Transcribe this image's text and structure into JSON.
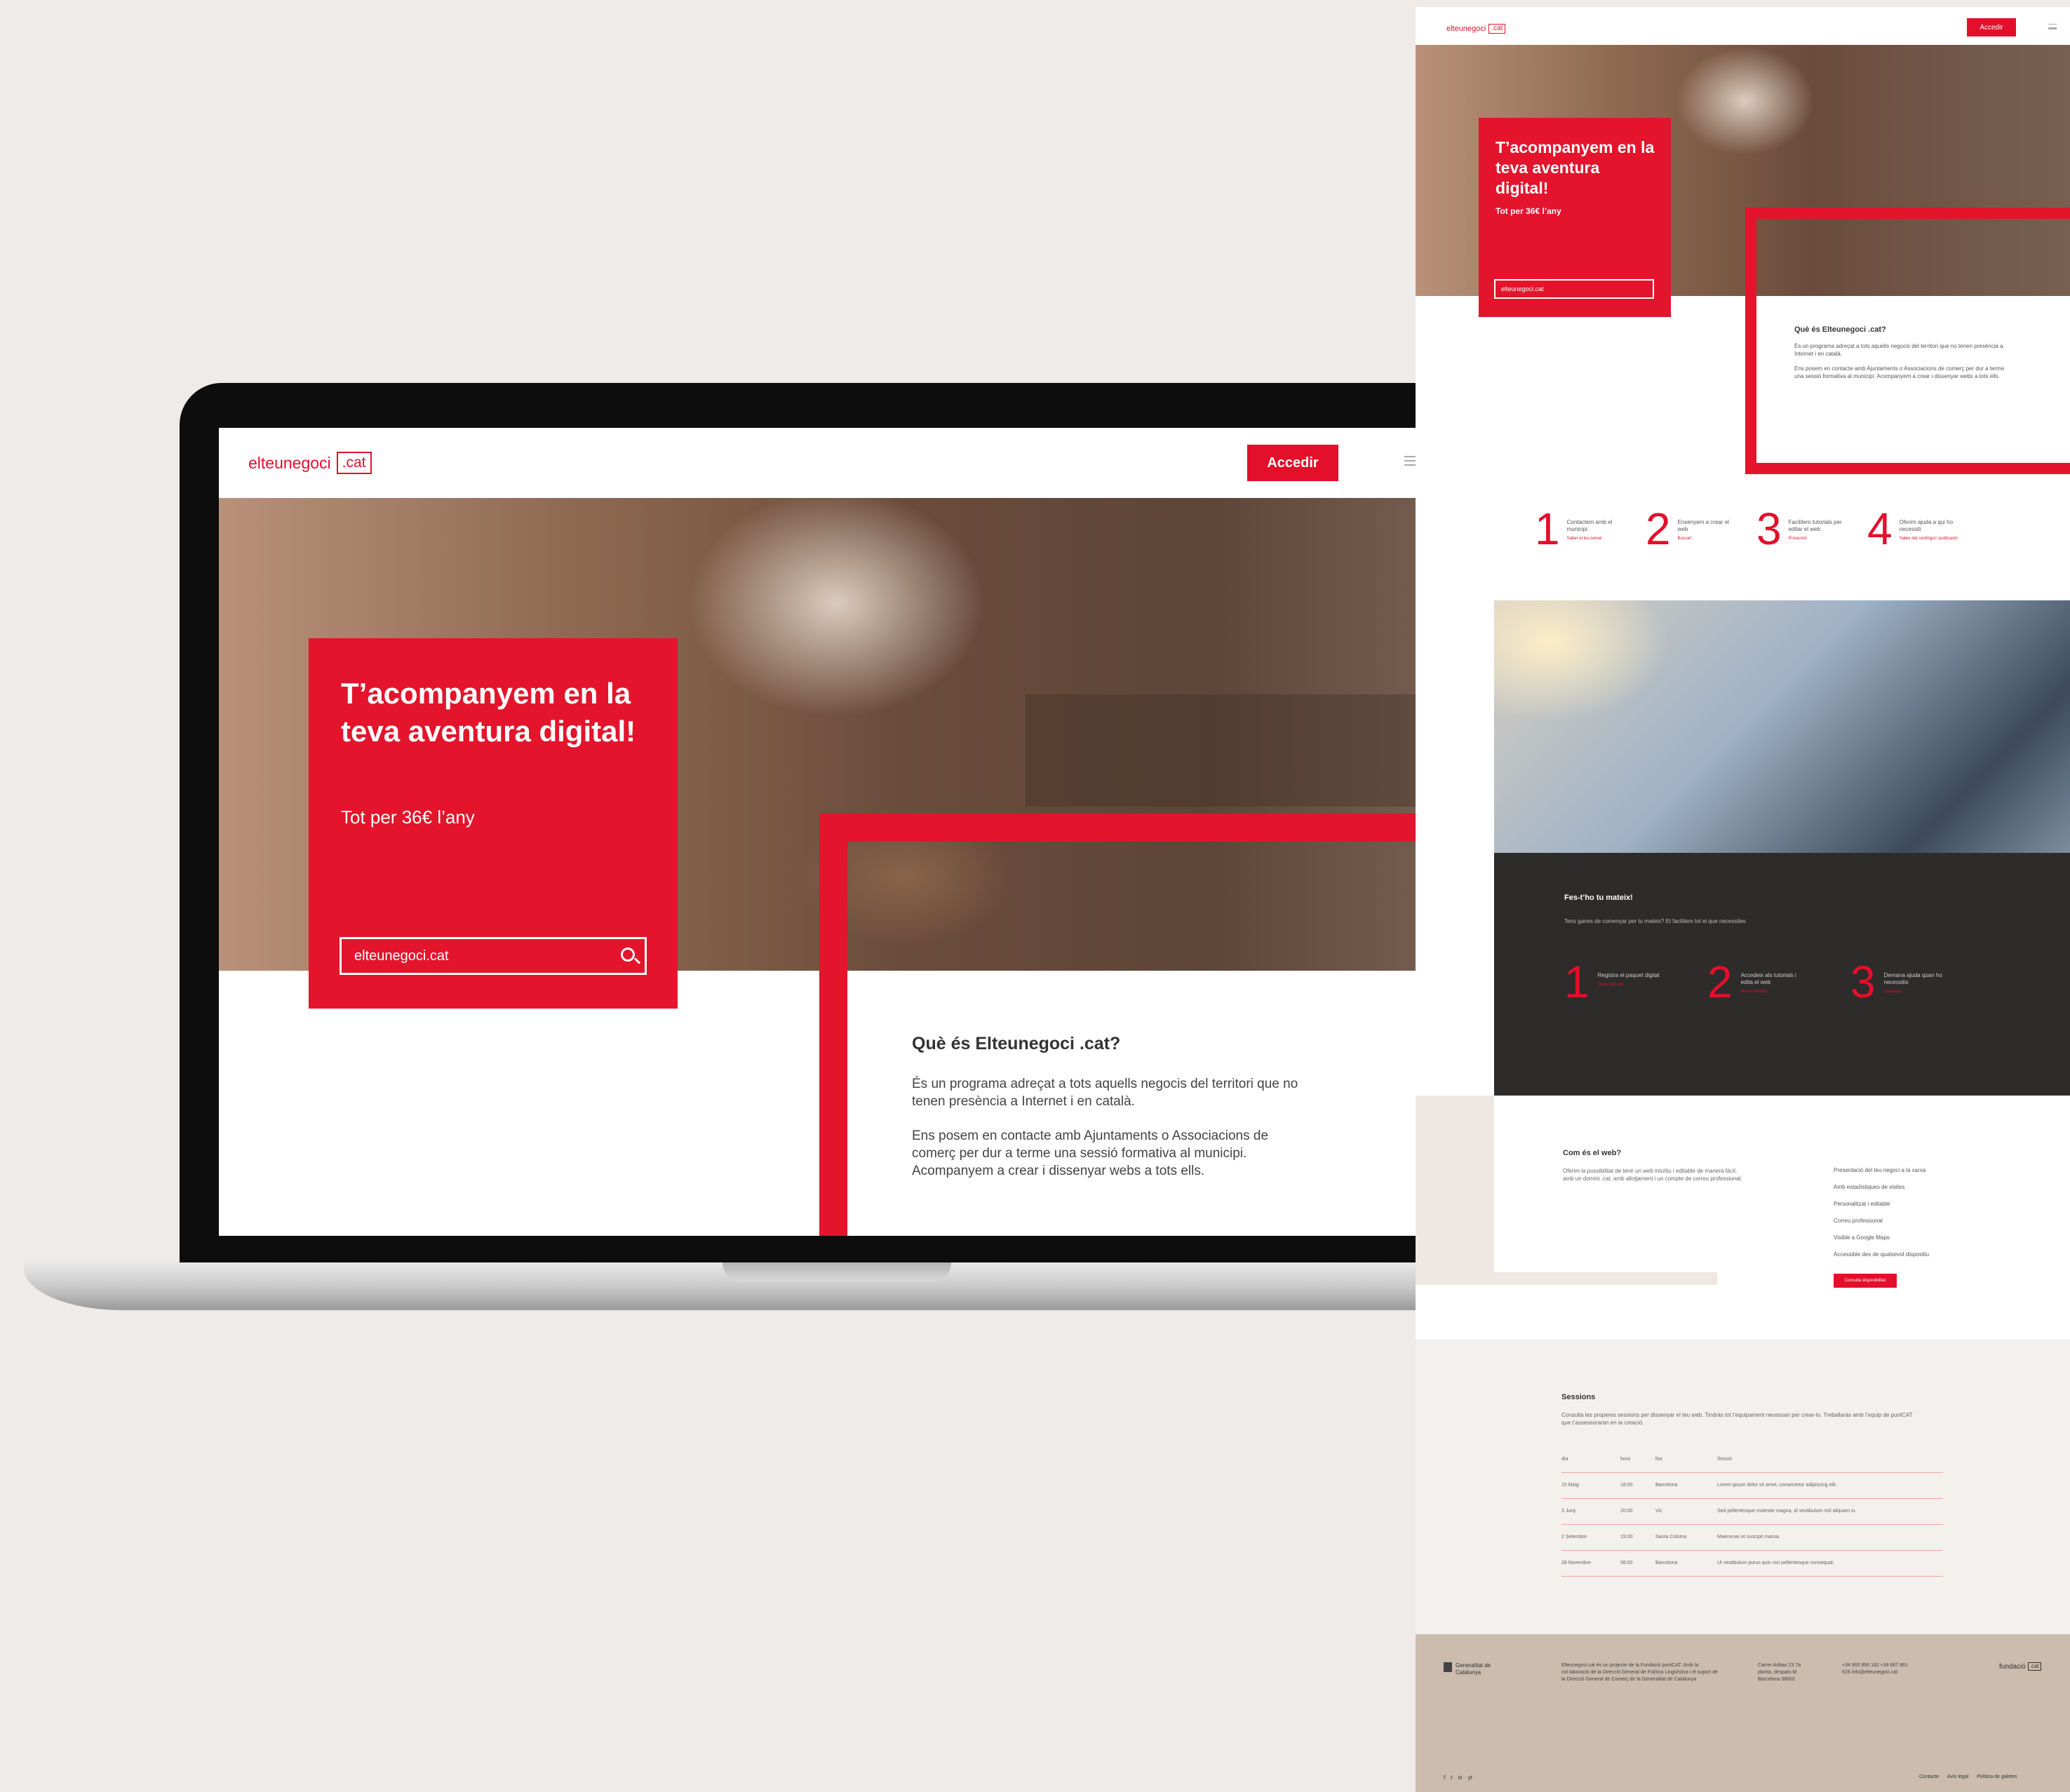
{
  "brand": {
    "name": "elteunegoci",
    "tld": ".cat",
    "accent": "#e30f2b"
  },
  "nav": {
    "access_label": "Accedir"
  },
  "hero": {
    "title": "T’acompanyem en la teva aventura digital!",
    "subtitle": "Tot per 36€ l’any",
    "search_value": "elteunegoci.cat"
  },
  "about": {
    "heading": "Què és Elteunegoci .cat?",
    "p1": "És un programa adreçat a tots aquells negocis del territori que no tenen presència a Internet i en català.",
    "p2": "Ens posem en contacte amb Ajuntaments o Associacions de comerç per dur a terme una sessió formativa al municipi. Acompanyem a crear i dissenyar webs a tots ells."
  },
  "steps": [
    {
      "num": "1",
      "text": "Contactem amb el municipi",
      "link": "Saber el teu servei"
    },
    {
      "num": "2",
      "text": "Ensenyem a crear el web",
      "link": "Buscar!"
    },
    {
      "num": "3",
      "text": "Facilitem tutorials per editar el web",
      "link": "Prova-ho!"
    },
    {
      "num": "4",
      "text": "Oferim ajuda a qui ho necessiti",
      "link": "Saber del contingut i publicació"
    }
  ],
  "diy": {
    "heading": "Fes-t’ho tu mateix!",
    "intro": "Tens ganes de començar per tu mateix? Et facilitem tot el que necessites",
    "steps": [
      {
        "num": "1",
        "text": "Registra el paquet digital",
        "link": "Comença ara"
      },
      {
        "num": "2",
        "text": "Accedeix als tutorials i edita el web",
        "link": "Veure tutorials"
      },
      {
        "num": "3",
        "text": "Demana ajuda quan ho necessitis",
        "link": "Contacta"
      }
    ]
  },
  "web": {
    "heading": "Com és el web?",
    "desc": "Oferim la possibilitat de tenir un web intuïtiu i editable de manera fàcil, amb un domini .cat, amb allotjament i un compte de correu professional.",
    "features": [
      "Presentació del teu negoci a la xarxa",
      "Amb estadístiques de visites",
      "Personalitzat i editable",
      "Correu professional",
      "Visible a Google Maps",
      "Accessible des de qualsevol dispositiu"
    ],
    "button": "Consulta disponibilitat"
  },
  "sessions": {
    "heading": "Sessions",
    "intro": "Consulta les properes sessions per dissenyar el teu web. Tindràs tot l’equipament necessari per crear-lo. Treballaràs amb l’equip de puntCAT que t’assessoraran en la creació.",
    "columns": [
      "dia",
      "hora",
      "lloc",
      "Sessió"
    ],
    "rows": [
      [
        "15 Maig",
        "18:00",
        "Barcelona",
        "Lorem ipsum dolor sit amet, consectetur adipiscing elit."
      ],
      [
        "3 Juny",
        "20:00",
        "Vic",
        "Sed pellentesque molestie magna, id vestibulum nisl aliquam in."
      ],
      [
        "2 Setembre",
        "19:00",
        "Santa Coloma",
        "Maecenas et suscipit massa."
      ],
      [
        "28 Novembre",
        "08:00",
        "Barcelona",
        "Ut vestibulum purus quis nisi pellentesque consequat."
      ]
    ]
  },
  "footer": {
    "gov": "Generalitat de Catalunya",
    "about": "Elteunegoci.cat és un projecte de la Fundació puntCAT. Amb la col·laboració de la Direcció General de Política Lingüística i el suport de la Direcció General de Comerç de la Generalitat de Catalunya",
    "address": "Carrer Aribau 23 7a planta, despatx M Barcelona 08002",
    "contact": "+34 900 866 182 +34 667 861 615 info@elteunegoci.cat",
    "brand": "fundació",
    "brand_tag": ".cat",
    "social": [
      "f",
      "t",
      "in",
      "yt"
    ],
    "links": [
      "Contacte",
      "Avís legal",
      "Política de galetes"
    ]
  }
}
